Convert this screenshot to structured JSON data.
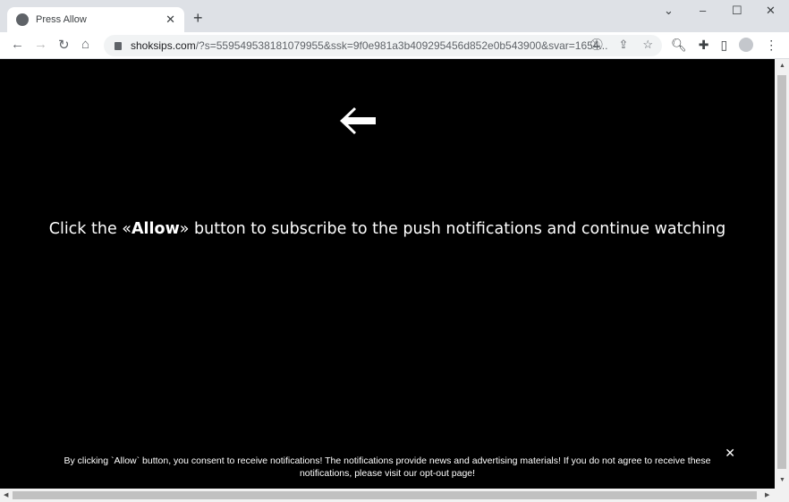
{
  "tab": {
    "title": "Press Allow",
    "close": "✕"
  },
  "new_tab": "+",
  "window": {
    "dropdown": "⌄",
    "minimize": "–",
    "maximize": "☐",
    "close": "✕"
  },
  "nav": {
    "back": "←",
    "forward": "→",
    "reload": "↻",
    "home": "⌂"
  },
  "address": {
    "host": "shoksips.com",
    "path": "/?s=559549538181079955&ssk=9f0e981a3b409295456d852e0b543900&svar=1654..."
  },
  "page": {
    "headline_pre": "Click the «",
    "headline_bold": "Allow",
    "headline_post": "» button to subscribe to the push notifications and continue watching",
    "banner_text": "By clicking `Allow` button, you consent to receive notifications! The notifications provide news and advertising materials! If you do not agree to receive these notifications, please visit our ",
    "banner_link": "opt-out page",
    "banner_end": "!",
    "banner_close": "✕"
  }
}
